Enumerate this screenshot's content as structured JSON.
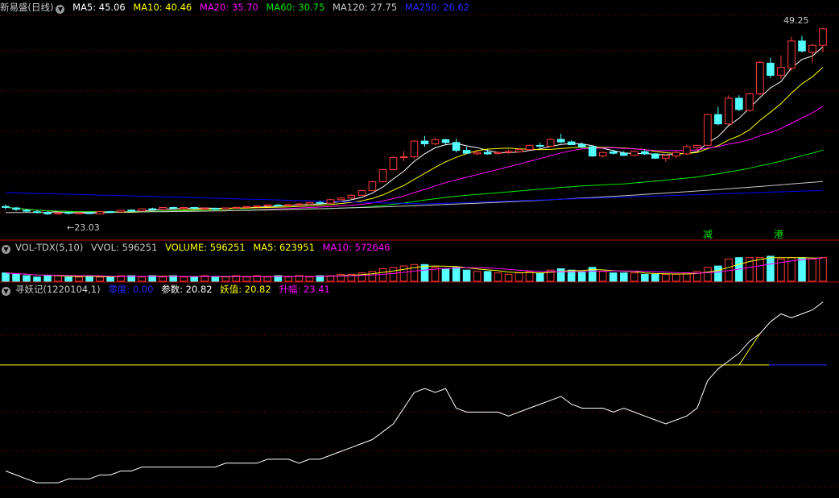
{
  "main_header": {
    "stock_name": "新易盛(日线)",
    "ma5": "MA5: 45.06",
    "ma10": "MA10: 40.46",
    "ma20": "MA20: 35.70",
    "ma60": "MA60: 30.75",
    "ma120": "MA120: 27.75",
    "ma250": "MA250: 26.62"
  },
  "price_marks": {
    "high": "49.25",
    "low": "23.03"
  },
  "signal_marks": {
    "jian": "减",
    "gang": "港"
  },
  "vol_header": {
    "name": "VOL-TDX(5,10)",
    "vvol": "VVOL: 596251",
    "volume": "VOLUME: 596251",
    "ma5": "MA5: 623951",
    "ma10": "MA10: 572646"
  },
  "ind_header": {
    "name": "寻妖记(1220104,1)",
    "lingdu": "零度: 0.00",
    "canshu": "参数: 20.82",
    "yaozhi": "妖值: 20.82",
    "shengfu": "升幅: 23.41"
  },
  "colors": {
    "up": "#ff3c3c",
    "down": "#54ffff",
    "ma5": "#ffffff",
    "ma10": "#ffff00",
    "ma20": "#ff00ff",
    "ma60": "#00e600",
    "ma120": "#c8c8c8",
    "ma250": "#0000ff",
    "grid": "#8c0000",
    "text": "#c8c8c8"
  },
  "chart_data": [
    {
      "type": "candlestick",
      "title": "新易盛(日线)",
      "ylim": [
        21.0,
        51.0
      ],
      "candles": [
        [
          24.25,
          24.52,
          23.82,
          24.12
        ],
        [
          24.05,
          24.18,
          23.62,
          23.85
        ],
        [
          23.72,
          23.92,
          23.42,
          23.58
        ],
        [
          23.52,
          23.72,
          23.3,
          23.42
        ],
        [
          23.42,
          23.58,
          23.03,
          23.22
        ],
        [
          23.22,
          23.48,
          23.1,
          23.36
        ],
        [
          23.4,
          23.52,
          23.12,
          23.32
        ],
        [
          23.22,
          23.42,
          23.15,
          23.36
        ],
        [
          23.36,
          23.52,
          23.22,
          23.28
        ],
        [
          23.22,
          23.62,
          23.18,
          23.52
        ],
        [
          23.52,
          23.66,
          23.4,
          23.46
        ],
        [
          23.5,
          23.78,
          23.45,
          23.72
        ],
        [
          23.74,
          23.86,
          23.55,
          23.6
        ],
        [
          23.62,
          24.0,
          23.56,
          23.92
        ],
        [
          23.92,
          24.08,
          23.82,
          23.88
        ],
        [
          23.86,
          24.18,
          23.8,
          24.1
        ],
        [
          24.1,
          24.2,
          23.92,
          23.98
        ],
        [
          23.98,
          24.22,
          23.86,
          24.1
        ],
        [
          24.1,
          24.18,
          23.88,
          23.96
        ],
        [
          23.92,
          24.12,
          23.82,
          24.02
        ],
        [
          24.0,
          24.08,
          23.78,
          23.86
        ],
        [
          23.86,
          24.1,
          23.8,
          24.04
        ],
        [
          24.04,
          24.22,
          23.96,
          24.12
        ],
        [
          24.12,
          24.3,
          24.04,
          24.22
        ],
        [
          24.22,
          24.4,
          24.12,
          24.3
        ],
        [
          24.3,
          24.52,
          24.2,
          24.46
        ],
        [
          24.44,
          24.62,
          24.3,
          24.4
        ],
        [
          24.4,
          24.58,
          24.3,
          24.48
        ],
        [
          24.48,
          24.72,
          24.4,
          24.6
        ],
        [
          24.6,
          24.86,
          24.5,
          24.8
        ],
        [
          24.8,
          25.05,
          24.62,
          24.7
        ],
        [
          24.7,
          25.32,
          24.65,
          25.2
        ],
        [
          25.2,
          25.55,
          25.1,
          25.42
        ],
        [
          25.42,
          25.92,
          25.3,
          25.82
        ],
        [
          25.82,
          26.62,
          25.75,
          26.48
        ],
        [
          26.48,
          27.82,
          26.4,
          27.7
        ],
        [
          27.7,
          29.52,
          27.6,
          29.4
        ],
        [
          29.4,
          31.3,
          29.3,
          31.1
        ],
        [
          31.1,
          32.0,
          30.6,
          31.2
        ],
        [
          31.2,
          33.52,
          31.0,
          33.4
        ],
        [
          33.4,
          34.12,
          32.6,
          33.02
        ],
        [
          33.02,
          33.82,
          32.8,
          33.6
        ],
        [
          33.6,
          33.72,
          32.9,
          33.2
        ],
        [
          33.2,
          33.72,
          31.8,
          32.1
        ],
        [
          32.1,
          32.6,
          31.62,
          31.7
        ],
        [
          31.62,
          32.02,
          31.4,
          31.82
        ],
        [
          31.82,
          32.22,
          31.48,
          31.62
        ],
        [
          31.66,
          31.92,
          31.4,
          31.8
        ],
        [
          31.8,
          32.2,
          31.6,
          31.94
        ],
        [
          31.9,
          32.4,
          31.8,
          32.2
        ],
        [
          32.2,
          32.9,
          32.1,
          32.8
        ],
        [
          32.8,
          33.2,
          32.4,
          32.68
        ],
        [
          32.68,
          33.8,
          32.6,
          33.62
        ],
        [
          33.64,
          34.42,
          33.1,
          33.28
        ],
        [
          33.28,
          33.54,
          32.82,
          32.9
        ],
        [
          32.92,
          33.2,
          32.4,
          32.6
        ],
        [
          32.6,
          32.82,
          31.2,
          31.3
        ],
        [
          31.3,
          31.92,
          31.1,
          31.8
        ],
        [
          31.9,
          32.2,
          31.5,
          31.7
        ],
        [
          31.7,
          32.0,
          31.3,
          31.4
        ],
        [
          31.4,
          32.1,
          31.3,
          31.96
        ],
        [
          31.92,
          32.2,
          31.42,
          31.62
        ],
        [
          31.6,
          31.72,
          30.9,
          31.0
        ],
        [
          31.0,
          31.5,
          30.5,
          31.4
        ],
        [
          31.3,
          32.12,
          31.0,
          31.8
        ],
        [
          31.6,
          32.9,
          31.4,
          32.62
        ],
        [
          32.5,
          32.9,
          31.9,
          32.8
        ],
        [
          32.8,
          37.2,
          32.7,
          37.1
        ],
        [
          37.1,
          38.2,
          35.6,
          35.8
        ],
        [
          35.8,
          39.8,
          35.6,
          39.4
        ],
        [
          39.4,
          39.8,
          37.6,
          37.82
        ],
        [
          37.7,
          40.2,
          37.5,
          40.02
        ],
        [
          40.0,
          44.6,
          39.8,
          44.42
        ],
        [
          44.3,
          45.1,
          42.2,
          42.6
        ],
        [
          42.62,
          45.4,
          42.1,
          43.7
        ],
        [
          43.6,
          48.0,
          43.2,
          47.4
        ],
        [
          47.4,
          48.1,
          45.8,
          46.0
        ],
        [
          45.82,
          47.0,
          44.4,
          46.8
        ],
        [
          46.8,
          49.25,
          45.8,
          49.1
        ]
      ]
    },
    {
      "type": "bar",
      "title": "VOL-TDX(5,10)",
      "values": [
        6,
        5,
        4,
        3,
        4,
        4,
        3,
        3,
        4,
        3,
        3,
        4,
        4,
        3,
        4,
        3,
        4,
        3,
        3,
        4,
        3,
        3,
        4,
        3,
        4,
        3,
        4,
        3,
        4,
        3,
        4,
        4,
        5,
        5,
        6,
        7,
        9,
        10,
        11,
        12,
        12,
        10,
        9,
        10,
        8,
        7,
        7,
        6,
        5,
        6,
        7,
        6,
        8,
        9,
        8,
        7,
        10,
        7,
        6,
        6,
        6,
        5,
        5,
        5,
        5,
        6,
        7,
        10,
        11,
        16,
        17,
        17,
        17,
        18,
        16,
        17,
        17,
        16,
        17
      ],
      "up": [
        0,
        0,
        0,
        0,
        0,
        1,
        0,
        1,
        0,
        1,
        0,
        1,
        0,
        1,
        0,
        1,
        0,
        1,
        0,
        1,
        0,
        1,
        1,
        1,
        1,
        1,
        0,
        1,
        1,
        1,
        0,
        1,
        1,
        1,
        1,
        1,
        1,
        1,
        1,
        1,
        0,
        1,
        0,
        0,
        0,
        1,
        0,
        1,
        1,
        1,
        1,
        0,
        1,
        0,
        0,
        0,
        0,
        1,
        0,
        0,
        1,
        0,
        0,
        1,
        1,
        1,
        1,
        1,
        0,
        1,
        0,
        1,
        1,
        0,
        1,
        1,
        0,
        1,
        1
      ],
      "ylim": [
        0,
        18
      ]
    },
    {
      "type": "line",
      "title": "寻妖记(1220104,1)",
      "series": [
        {
          "name": "参数",
          "values": [
            4,
            3,
            2,
            1,
            1,
            1,
            2,
            2,
            2,
            3,
            3,
            4,
            4,
            5,
            5,
            5,
            5,
            5,
            5,
            5,
            5,
            6,
            6,
            6,
            6,
            7,
            7,
            7,
            6,
            7,
            7,
            8,
            9,
            10,
            11,
            12,
            14,
            16,
            20,
            24,
            25,
            24,
            25,
            20,
            19,
            19,
            19,
            19,
            18,
            19,
            20,
            21,
            22,
            23,
            21,
            20,
            20,
            20,
            19,
            20,
            19,
            18,
            17,
            16,
            17,
            18,
            20,
            27,
            30,
            32,
            34,
            37,
            39,
            42,
            44,
            43,
            44,
            45,
            47
          ]
        }
      ],
      "reference_line": 31,
      "ylim": [
        0,
        48
      ]
    }
  ]
}
